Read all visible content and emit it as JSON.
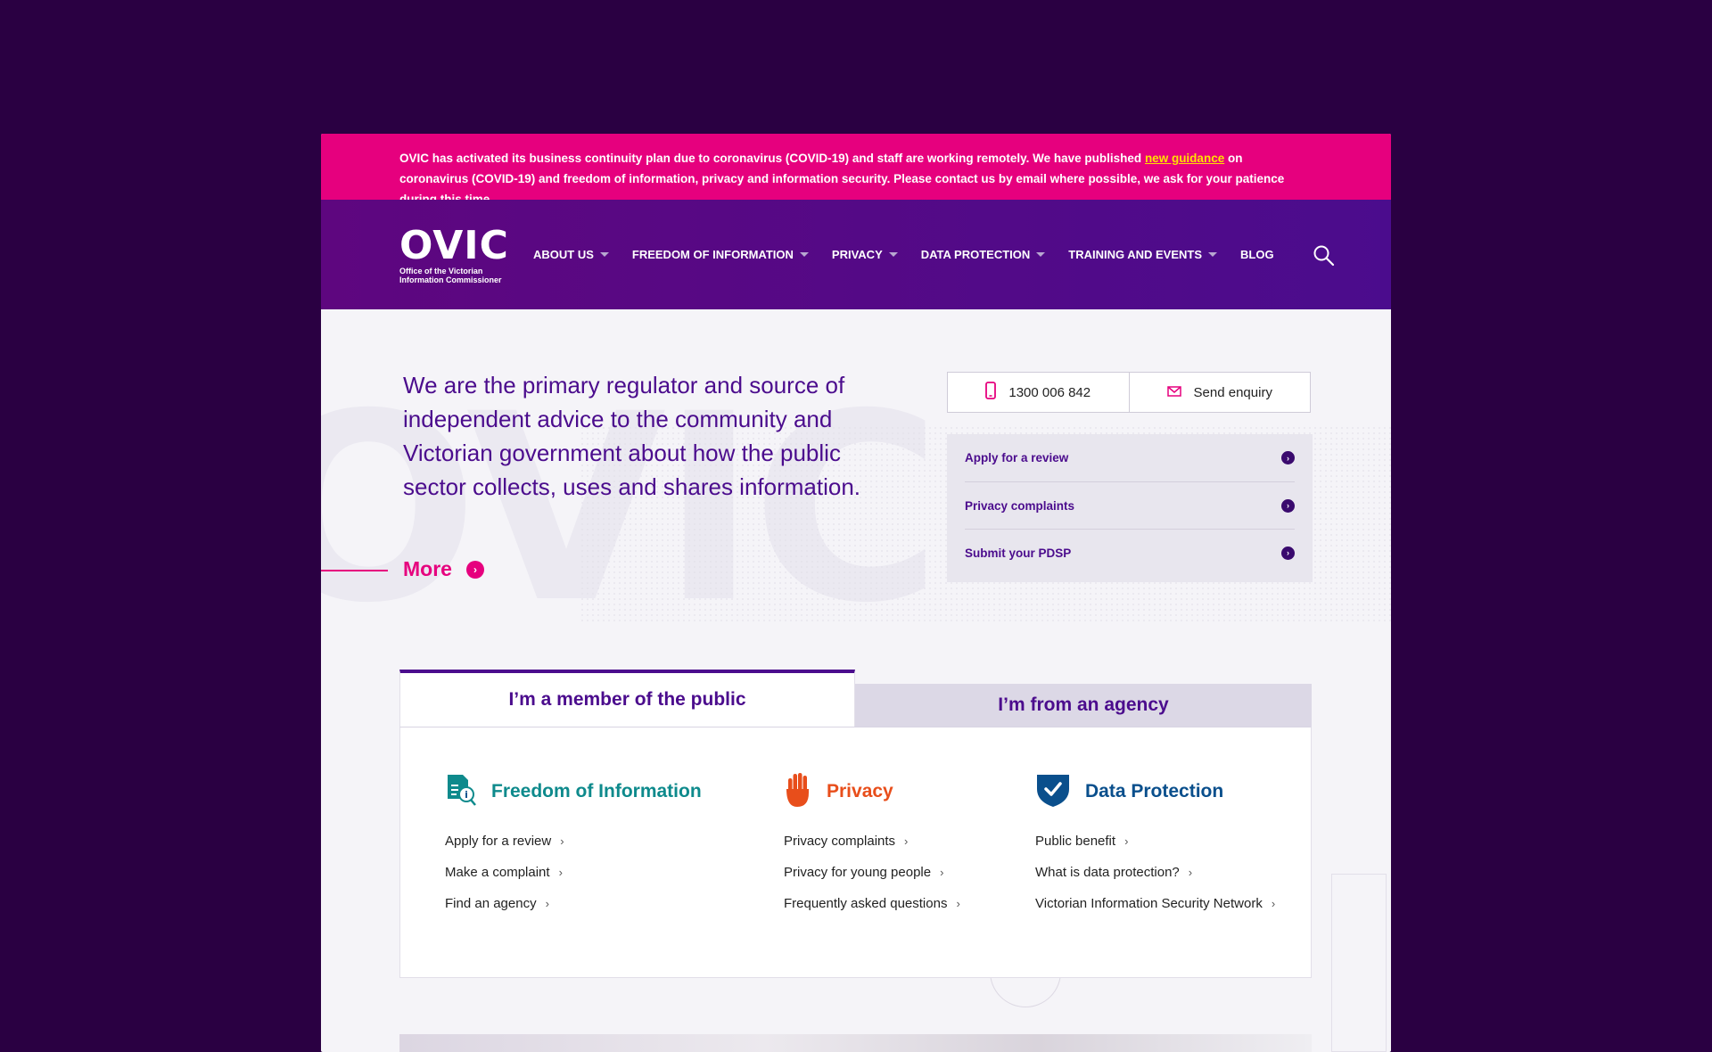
{
  "alert": {
    "text_before": "OVIC has activated its business continuity plan due to coronavirus (COVID-19) and staff are working remotely. We have published ",
    "link": "new guidance",
    "text_after": " on coronavirus (COVID-19) and freedom of information, privacy and information security. Please contact us by email where possible, we ask for your patience during this time."
  },
  "logo": {
    "main": "OVIC",
    "sub_line1": "Office of the Victorian",
    "sub_line2": "Information Commissioner"
  },
  "nav": [
    {
      "label": "ABOUT US",
      "dropdown": true
    },
    {
      "label": "FREEDOM OF INFORMATION",
      "dropdown": true
    },
    {
      "label": "PRIVACY",
      "dropdown": true
    },
    {
      "label": "DATA PROTECTION",
      "dropdown": true
    },
    {
      "label": "TRAINING AND EVENTS",
      "dropdown": true
    },
    {
      "label": "BLOG",
      "dropdown": false
    }
  ],
  "hero": {
    "watermark": "OVIC",
    "text": "We are the primary regulator and source of independent advice to the community and Victorian government about how the public sector collects, uses and shares information.",
    "more": "More"
  },
  "contact": {
    "phone": "1300 006 842",
    "enquiry": "Send enquiry"
  },
  "quick_links": [
    {
      "label": "Apply for a review"
    },
    {
      "label": "Privacy complaints"
    },
    {
      "label": "Submit your PDSP"
    }
  ],
  "tabs": {
    "active": "I’m a member of the public",
    "inactive": "I’m from an agency"
  },
  "columns": [
    {
      "title": "Freedom of Information",
      "color": "#0e8a8c",
      "icon": "document-info-icon",
      "links": [
        "Apply for a review",
        "Make a complaint",
        "Find an agency"
      ]
    },
    {
      "title": "Privacy",
      "color": "#e84e1b",
      "icon": "hand-icon",
      "links": [
        "Privacy complaints",
        "Privacy for young people",
        "Frequently asked questions"
      ]
    },
    {
      "title": "Data Protection",
      "color": "#0a4f8c",
      "icon": "shield-check-icon",
      "links": [
        "Public benefit",
        "What is data protection?",
        "Victorian Information Security Network"
      ]
    }
  ],
  "colors": {
    "background": "#2a0042",
    "alert": "#e6007e",
    "header": "#5e067f",
    "brand_purple": "#4b0c8d",
    "accent_pink": "#e6007e"
  }
}
